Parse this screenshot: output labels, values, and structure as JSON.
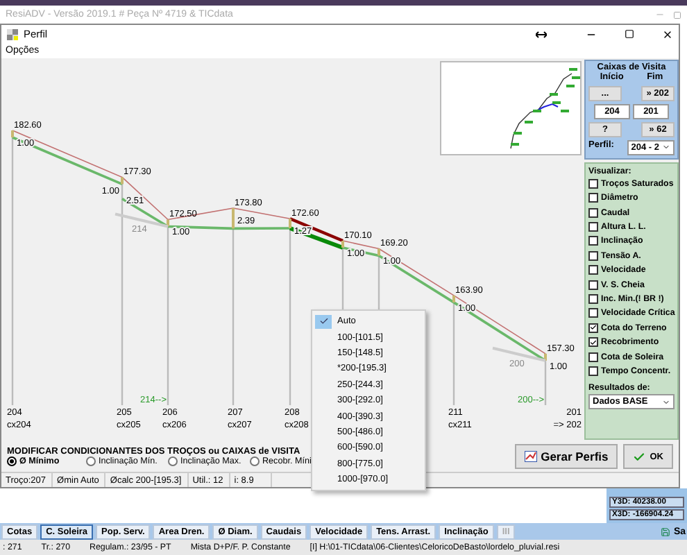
{
  "app": {
    "title": "ResiADV - Versão 2019.1 # Peça Nº 4719 & TICdata"
  },
  "window": {
    "title": "Perfil",
    "menu": [
      "Opções"
    ]
  },
  "profile": {
    "nodes": [
      {
        "elevation": "182.60",
        "depths": [
          "1.00"
        ],
        "id": "204",
        "label": "cx204"
      },
      {
        "elevation": "177.30",
        "depths": [
          "1.00",
          "2.51"
        ],
        "id": "205",
        "label": "cx205"
      },
      {
        "elevation": "172.50",
        "depths": [
          "1.00"
        ],
        "id": "206",
        "label": "cx206",
        "inflow": "214",
        "outflow": "214-->"
      },
      {
        "elevation": "173.80",
        "depths": [
          "2.39"
        ],
        "id": "207",
        "label": "cx207"
      },
      {
        "elevation": "172.60",
        "depths": [
          "1.27"
        ],
        "id": "208",
        "label": "cx208"
      },
      {
        "elevation": "170.10",
        "depths": [
          "1.00"
        ]
      },
      {
        "elevation": "169.20",
        "depths": [
          "1.00"
        ]
      },
      {
        "elevation": "163.90",
        "depths": [
          "1.00"
        ],
        "id": "211",
        "label": "cx211"
      },
      {
        "elevation": "157.30",
        "depths": [
          "1.00"
        ],
        "id": "201",
        "label": "=> 202",
        "inflow": "200",
        "outflow": "200-->"
      }
    ],
    "segments": [
      {
        "selected": false
      },
      {
        "selected": false
      },
      {
        "selected": false
      },
      {
        "selected": false
      },
      {
        "selected": true
      },
      {
        "selected": false
      },
      {
        "selected": false
      },
      {
        "selected": false
      }
    ]
  },
  "diameter_menu": {
    "items": [
      {
        "label": "Auto",
        "checked": true
      },
      {
        "label": "100-[101.5]",
        "checked": false
      },
      {
        "label": "150-[148.5]",
        "checked": false
      },
      {
        "label": "*200-[195.3]",
        "checked": false
      },
      {
        "label": "250-[244.3]",
        "checked": false
      },
      {
        "label": "300-[292.0]",
        "checked": false
      },
      {
        "label": "400-[390.3]",
        "checked": false
      },
      {
        "label": "500-[486.0]",
        "checked": false
      },
      {
        "label": "600-[590.0]",
        "checked": false
      },
      {
        "label": "800-[775.0]",
        "checked": false
      },
      {
        "label": "1000-[970.0]",
        "checked": false
      }
    ]
  },
  "manholes": {
    "title": "Caixas de Visita",
    "start_label": "Início",
    "end_label": "Fim",
    "browse_button": "...",
    "next_button": "» 202",
    "start": "204",
    "end": "201",
    "help_button": "?",
    "next_end_button": "» 62",
    "profile_label": "Perfil:",
    "profile_value": "204 - 2"
  },
  "visualize": {
    "title": "Visualizar:",
    "options": [
      {
        "label": "Troços Saturados",
        "checked": false
      },
      {
        "label": "Diâmetro",
        "checked": false
      },
      {
        "label": "Caudal",
        "checked": false
      },
      {
        "label": "Altura L. L.",
        "checked": false
      },
      {
        "label": "Inclinação",
        "checked": false
      },
      {
        "label": "Tensão A.",
        "checked": false
      },
      {
        "label": "Velocidade",
        "checked": false
      },
      {
        "label": "V. S. Cheia",
        "checked": false
      },
      {
        "label": "Inc. Min.(! BR !)",
        "checked": false
      },
      {
        "label": "Velocidade Crítica",
        "checked": false
      },
      {
        "label": "Cota do Terreno",
        "checked": true
      },
      {
        "label": "Recobrimento",
        "checked": true
      },
      {
        "label": "Cota de Soleira",
        "checked": false
      },
      {
        "label": "Tempo Concentr.",
        "checked": false
      }
    ],
    "results_label": "Resultados de:",
    "results_value": "Dados BASE"
  },
  "modify": {
    "title": "MODIFICAR CONDICIONANTES DOS TROÇOS ou CAIXAS de VISITA",
    "options": [
      {
        "label": "Ø Mínimo",
        "selected": true
      },
      {
        "label": "Inclinação Mín.",
        "selected": false
      },
      {
        "label": "Inclinação Max.",
        "selected": false
      },
      {
        "label": "Recobr. Míni",
        "selected": false
      }
    ]
  },
  "buttons": [
    {
      "label": "Gerar Perfis",
      "kind": "generate"
    },
    {
      "label": "OK",
      "kind": "ok"
    }
  ],
  "segment_status": [
    "Troço:207",
    "Ømin Auto",
    "Øcalc 200-[195.3]",
    "Util.: 12",
    "i: 8.9"
  ],
  "coordinates": [
    "Y3D: 40238.00",
    "X3D: -166904.24"
  ],
  "tabs": [
    {
      "label": "Cotas",
      "selected": false,
      "disabled": false
    },
    {
      "label": "C. Soleira",
      "selected": true,
      "disabled": false
    },
    {
      "label": "Pop. Serv.",
      "selected": false,
      "disabled": false
    },
    {
      "label": "Area Dren.",
      "selected": false,
      "disabled": false
    },
    {
      "label": "Ø Diam.",
      "selected": false,
      "disabled": false
    },
    {
      "label": "Caudais",
      "selected": false,
      "disabled": false
    },
    {
      "label": "Velocidade",
      "selected": false,
      "disabled": false
    },
    {
      "label": "Tens. Arrast.",
      "selected": false,
      "disabled": false
    },
    {
      "label": "Inclinação",
      "selected": false,
      "disabled": false
    },
    {
      "label": "III",
      "selected": false,
      "disabled": true
    }
  ],
  "tab_extra": "Sa",
  "status_bar": [
    ": 271",
    "Tr.: 270",
    "Regulam.: 23/95 - PT",
    "Mista D+P/F. P. Constante",
    "[I] H:\\01-TICdata\\06-Clientes\\CeloricoDeBasto\\lordelo_pluvial.resi"
  ]
}
